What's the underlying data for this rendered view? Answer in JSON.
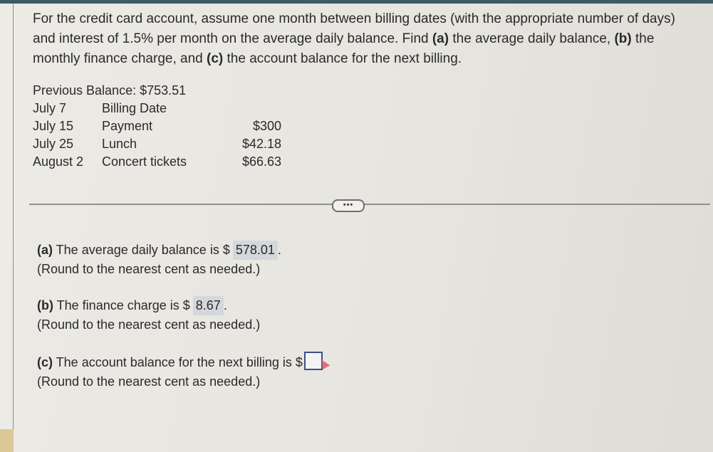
{
  "problem": {
    "text_1": "For the credit card account, assume one month between billing dates (with the appropriate number of days) and interest of 1.5% per month on the average daily balance. Find ",
    "a_label": "(a)",
    "text_2": " the average daily balance, ",
    "b_label": "(b)",
    "text_3": " the monthly finance charge, and ",
    "c_label": "(c)",
    "text_4": " the account balance for the next billing."
  },
  "statement": {
    "previous_balance": "Previous Balance: $753.51",
    "rows": [
      {
        "date": "July 7",
        "description": "Billing Date",
        "amount": ""
      },
      {
        "date": "July 15",
        "description": "Payment",
        "amount": "$300"
      },
      {
        "date": "July 25",
        "description": "Lunch",
        "amount": "$42.18"
      },
      {
        "date": "August 2",
        "description": "Concert tickets",
        "amount": "$66.63"
      }
    ]
  },
  "more_button": "•••",
  "answers": {
    "a": {
      "label": "(a)",
      "text": " The average daily balance is $",
      "value": "578.01",
      "suffix": ".",
      "hint": "(Round to the nearest cent as needed.)"
    },
    "b": {
      "label": "(b)",
      "text": " The finance charge is $",
      "value": "8.67",
      "suffix": ".",
      "hint": "(Round to the nearest cent as needed.)"
    },
    "c": {
      "label": "(c)",
      "text": " The account balance for the next billing is $",
      "value": "",
      "hint": "(Round to the nearest cent as needed.)"
    }
  }
}
